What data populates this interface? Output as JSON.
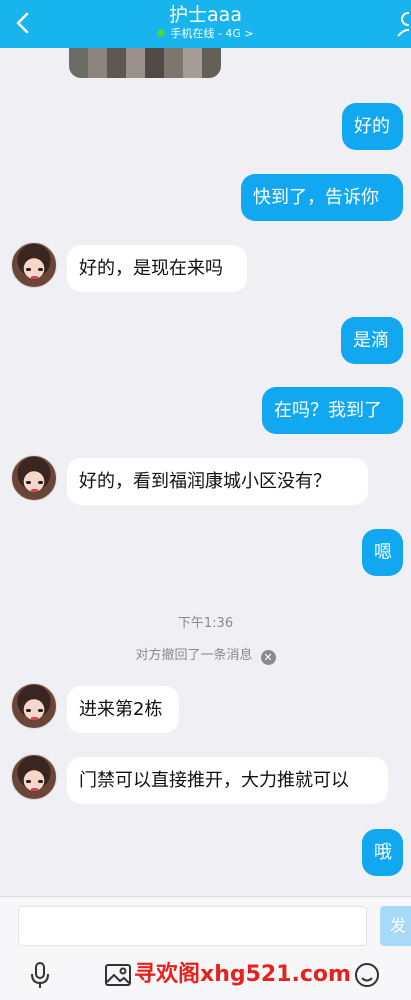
{
  "header": {
    "title": "护士aaa",
    "status": "手机在线 - 4G",
    "status_arrow": ">",
    "bg_color": "#18b4ee"
  },
  "messages": [
    {
      "side": "out",
      "text": "好的"
    },
    {
      "side": "out",
      "text": "快到了，告诉你"
    },
    {
      "side": "in",
      "text": "好的，是现在来吗"
    },
    {
      "side": "out",
      "text": "是滴"
    },
    {
      "side": "out",
      "text": "在吗？我到了"
    },
    {
      "side": "in",
      "text": "好的，看到福润康城小区没有？"
    },
    {
      "side": "out",
      "text": "嗯"
    },
    {
      "side": "in",
      "text": "进来第2栋"
    },
    {
      "side": "in",
      "text": "门禁可以直接推开，大力推就可以"
    },
    {
      "side": "out",
      "text": "哦"
    }
  ],
  "system": {
    "time": "下午1:36",
    "recall_notice": "对方撤回了一条消息"
  },
  "input": {
    "placeholder": "",
    "send_label": "发"
  },
  "toolbar": {
    "icons": [
      "microphone-icon",
      "image-icon",
      "emoji-icon"
    ]
  },
  "watermark": "寻欢阁xhg521.com",
  "colors": {
    "outgoing_bubble": "#12a8f1",
    "incoming_bubble": "#ffffff",
    "watermark": "#e8211f"
  }
}
